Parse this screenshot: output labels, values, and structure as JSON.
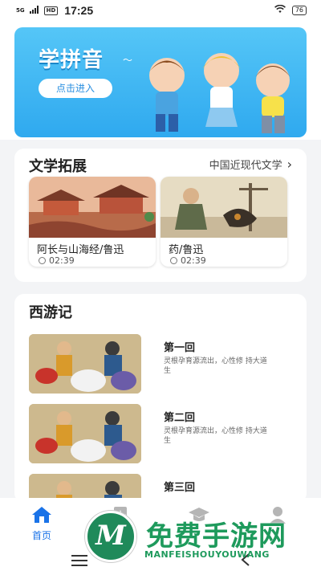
{
  "status_bar": {
    "signal": "5G",
    "hd": "HD",
    "time": "17:25",
    "battery": "76"
  },
  "banner": {
    "title": "学拼音",
    "button_label": "点击进入",
    "deco": "〜"
  },
  "section_literature": {
    "title": "文学拓展",
    "more_label": "中国近现代文学",
    "items": [
      {
        "title": "阿长与山海经/鲁迅",
        "duration": "02:39"
      },
      {
        "title": "药/鲁迅",
        "duration": "02:39"
      }
    ]
  },
  "section_xiyouji": {
    "title": "西游记",
    "episodes": [
      {
        "title": "第一回",
        "desc": "灵根孕育源流出，心性修 持大道生"
      },
      {
        "title": "第二回",
        "desc": "灵根孕育源流出，心性修 持大道生"
      },
      {
        "title": "第三回",
        "desc": ""
      }
    ]
  },
  "bottom_nav": {
    "items": [
      {
        "label": "首页",
        "icon": "home-icon"
      },
      {
        "label": "",
        "icon": "book-icon"
      },
      {
        "label": "",
        "icon": "graduation-cap-icon"
      },
      {
        "label": "",
        "icon": "profile-icon"
      }
    ]
  },
  "watermark": {
    "logo_letter": "M",
    "text": "免费手游网",
    "subtext": "MANFEISHOUYOUWANG"
  },
  "colors": {
    "accent": "#1a73e8",
    "banner": "#2fa9ef",
    "watermark": "#1e9a5c"
  }
}
